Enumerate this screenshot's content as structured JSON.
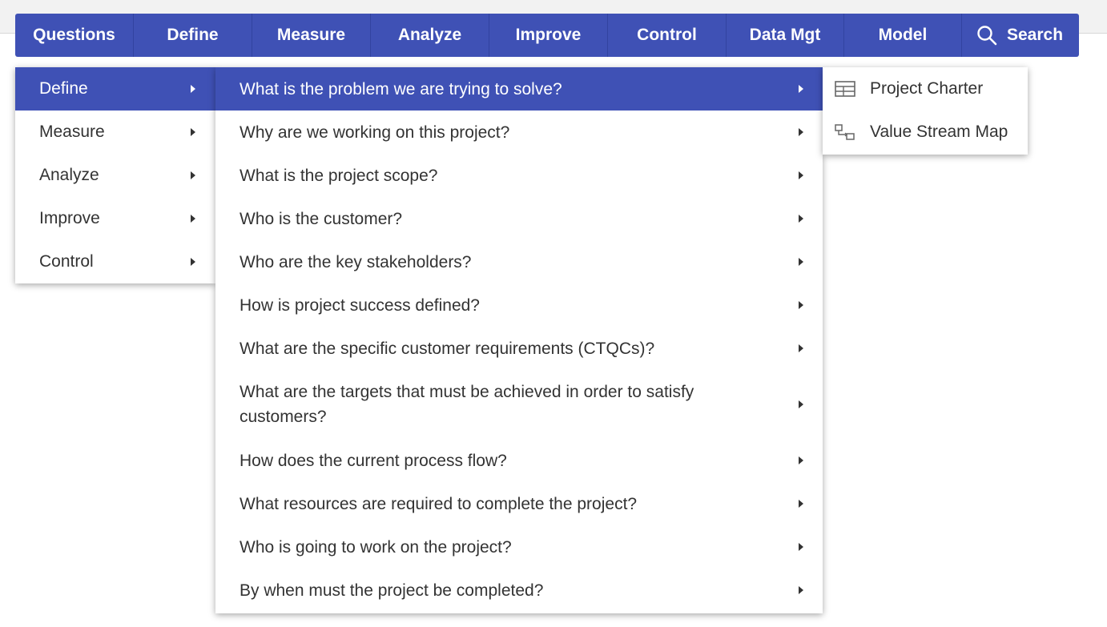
{
  "navbar": {
    "items": [
      {
        "label": "Questions"
      },
      {
        "label": "Define"
      },
      {
        "label": "Measure"
      },
      {
        "label": "Analyze"
      },
      {
        "label": "Improve"
      },
      {
        "label": "Control"
      },
      {
        "label": "Data Mgt"
      },
      {
        "label": "Model"
      }
    ],
    "search_label": "Search",
    "accent_color": "#3f51b5"
  },
  "menu_level1": {
    "items": [
      {
        "label": "Define",
        "selected": true
      },
      {
        "label": "Measure"
      },
      {
        "label": "Analyze"
      },
      {
        "label": "Improve"
      },
      {
        "label": "Control"
      }
    ]
  },
  "menu_level2": {
    "items": [
      {
        "label": "What is the problem we are trying to solve?",
        "selected": true
      },
      {
        "label": "Why are we working on this project?"
      },
      {
        "label": "What is the project scope?"
      },
      {
        "label": "Who is the customer?"
      },
      {
        "label": "Who are the key stakeholders?"
      },
      {
        "label": "How is project success defined?"
      },
      {
        "label": "What are the specific customer requirements (CTQCs)?"
      },
      {
        "label": "What are the targets that must be achieved in order to satisfy customers?"
      },
      {
        "label": "How does the current process flow?"
      },
      {
        "label": "What resources are required to complete the project?"
      },
      {
        "label": "Who is going to work on the project?"
      },
      {
        "label": "By when must the project be completed?"
      }
    ]
  },
  "menu_level3": {
    "items": [
      {
        "label": "Project Charter",
        "icon": "table-icon"
      },
      {
        "label": "Value Stream Map",
        "icon": "flow-map-icon"
      }
    ]
  }
}
